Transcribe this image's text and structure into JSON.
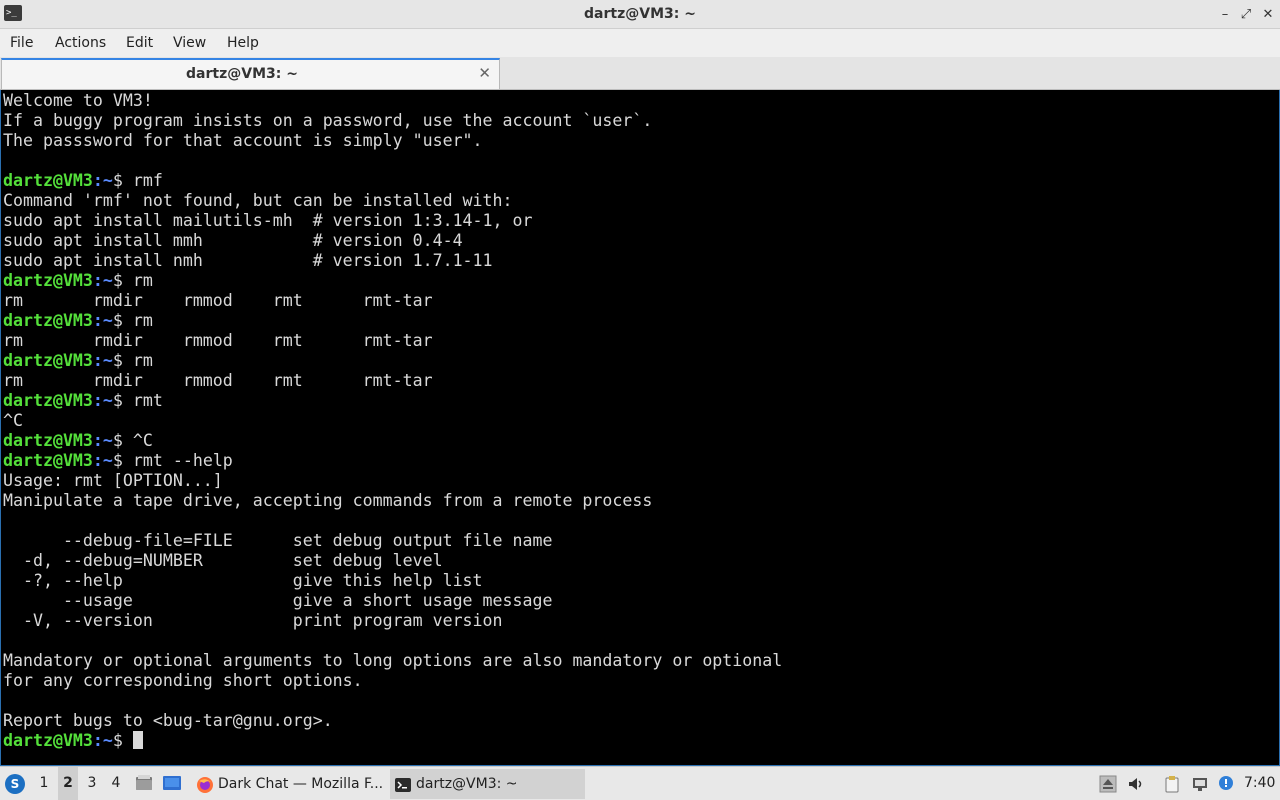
{
  "window": {
    "title": "dartz@VM3: ~",
    "app_icon_glyph": ">_",
    "controls": [
      "–",
      "⤢",
      "✕"
    ]
  },
  "menubar": {
    "items": [
      "File",
      "Actions",
      "Edit",
      "View",
      "Help"
    ]
  },
  "tabs": [
    {
      "label": "dartz@VM3: ~",
      "close_glyph": "✕"
    }
  ],
  "terminal": {
    "prompt_user": "dartz@VM3",
    "prompt_path": ":~",
    "prompt_symbol": "$ ",
    "lines": [
      {
        "type": "out",
        "text": "Welcome to VM3!"
      },
      {
        "type": "out",
        "text": "If a buggy program insists on a password, use the account `user`."
      },
      {
        "type": "out",
        "text": "The passsword for that account is simply \"user\"."
      },
      {
        "type": "out",
        "text": ""
      },
      {
        "type": "cmd",
        "text": "rmf"
      },
      {
        "type": "out",
        "text": "Command 'rmf' not found, but can be installed with:"
      },
      {
        "type": "out",
        "text": "sudo apt install mailutils-mh  # version 1:3.14-1, or"
      },
      {
        "type": "out",
        "text": "sudo apt install mmh           # version 0.4-4"
      },
      {
        "type": "out",
        "text": "sudo apt install nmh           # version 1.7.1-11"
      },
      {
        "type": "cmd",
        "text": "rm"
      },
      {
        "type": "out",
        "text": "rm       rmdir    rmmod    rmt      rmt-tar"
      },
      {
        "type": "cmd",
        "text": "rm"
      },
      {
        "type": "out",
        "text": "rm       rmdir    rmmod    rmt      rmt-tar"
      },
      {
        "type": "cmd",
        "text": "rm"
      },
      {
        "type": "out",
        "text": "rm       rmdir    rmmod    rmt      rmt-tar"
      },
      {
        "type": "cmd",
        "text": "rmt"
      },
      {
        "type": "out",
        "text": "^C"
      },
      {
        "type": "cmd",
        "text": "^C"
      },
      {
        "type": "cmd",
        "text": "rmt --help"
      },
      {
        "type": "out",
        "text": "Usage: rmt [OPTION...]"
      },
      {
        "type": "out",
        "text": "Manipulate a tape drive, accepting commands from a remote process"
      },
      {
        "type": "out",
        "text": ""
      },
      {
        "type": "out",
        "text": "      --debug-file=FILE      set debug output file name"
      },
      {
        "type": "out",
        "text": "  -d, --debug=NUMBER         set debug level"
      },
      {
        "type": "out",
        "text": "  -?, --help                 give this help list"
      },
      {
        "type": "out",
        "text": "      --usage                give a short usage message"
      },
      {
        "type": "out",
        "text": "  -V, --version              print program version"
      },
      {
        "type": "out",
        "text": ""
      },
      {
        "type": "out",
        "text": "Mandatory or optional arguments to long options are also mandatory or optional"
      },
      {
        "type": "out",
        "text": "for any corresponding short options."
      },
      {
        "type": "out",
        "text": ""
      },
      {
        "type": "out",
        "text": "Report bugs to <bug-tar@gnu.org>."
      },
      {
        "type": "cmd",
        "text": "",
        "cursor": true
      }
    ]
  },
  "taskbar": {
    "start_glyph": "S",
    "workspaces": [
      {
        "label": "1",
        "active": false
      },
      {
        "label": "2",
        "active": true
      },
      {
        "label": "3",
        "active": false
      },
      {
        "label": "4",
        "active": false
      }
    ],
    "tasks": [
      {
        "label": "Dark Chat — Mozilla F...",
        "icon": "firefox-icon",
        "active": false
      },
      {
        "label": "dartz@VM3: ~",
        "icon": "terminal-icon",
        "active": true
      }
    ],
    "clock": "7:40",
    "colors": {
      "firefox": "#ff7139",
      "terminal": "#2b2b2b",
      "accent": "#3584e4"
    }
  }
}
